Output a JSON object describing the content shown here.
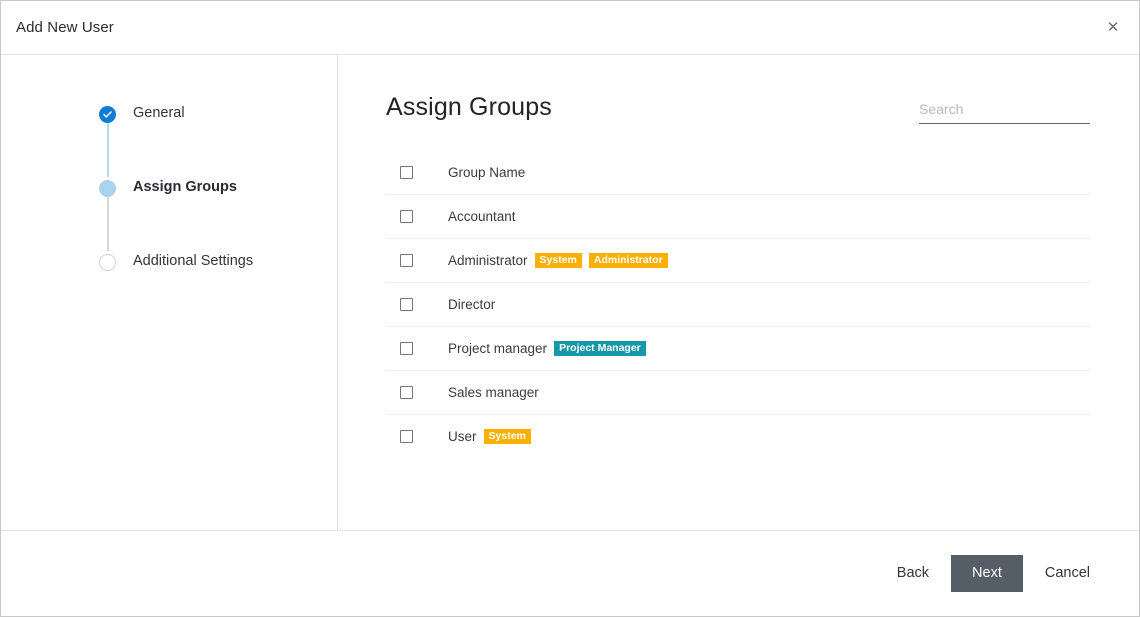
{
  "window": {
    "title": "Add New User",
    "close_label": "✕"
  },
  "stepper": {
    "steps": [
      {
        "label": "General",
        "state": "done",
        "icon": "check-icon"
      },
      {
        "label": "Assign Groups",
        "state": "active",
        "icon": "dot-icon"
      },
      {
        "label": "Additional Settings",
        "state": "todo",
        "icon": "circle-outline-icon"
      }
    ]
  },
  "main": {
    "title": "Assign Groups",
    "search": {
      "placeholder": "Search",
      "value": ""
    },
    "list": {
      "header": {
        "label": "Group Name",
        "checked": false
      },
      "rows": [
        {
          "label": "Accountant",
          "checked": false,
          "badges": []
        },
        {
          "label": "Administrator",
          "checked": false,
          "badges": [
            {
              "text": "System",
              "color": "amber"
            },
            {
              "text": "Administrator",
              "color": "amber"
            }
          ]
        },
        {
          "label": "Director",
          "checked": false,
          "badges": []
        },
        {
          "label": "Project manager",
          "checked": false,
          "badges": [
            {
              "text": "Project Manager",
              "color": "teal"
            }
          ]
        },
        {
          "label": "Sales manager",
          "checked": false,
          "badges": []
        },
        {
          "label": "User",
          "checked": false,
          "badges": [
            {
              "text": "System",
              "color": "amber"
            }
          ]
        }
      ]
    }
  },
  "footer": {
    "back_label": "Back",
    "next_label": "Next",
    "cancel_label": "Cancel"
  },
  "colors": {
    "step_done": "#0f7bd4",
    "step_active": "#a9d3f0",
    "badge_amber": "#fab005",
    "badge_teal": "#1798a8",
    "primary_button": "#555d66"
  }
}
